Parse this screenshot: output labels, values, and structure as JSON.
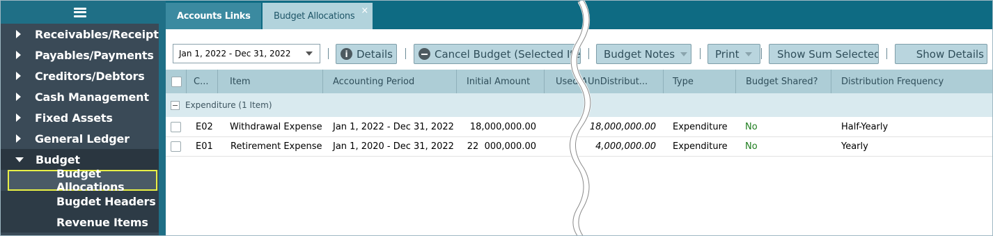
{
  "sidebar": {
    "items": [
      {
        "label": "Receivables/Receipts"
      },
      {
        "label": "Payables/Payments"
      },
      {
        "label": "Creditors/Debtors"
      },
      {
        "label": "Cash Management"
      },
      {
        "label": "Fixed Assets"
      },
      {
        "label": "General Ledger"
      },
      {
        "label": "Budget"
      }
    ],
    "sub_items": [
      {
        "label": "Budget Allocations",
        "active": true
      },
      {
        "label": "Bugdet Headers"
      },
      {
        "label": "Revenue Items"
      }
    ]
  },
  "tabs": [
    {
      "label": "Accounts Links"
    },
    {
      "label": "Budget Allocations",
      "active": true,
      "close": "×"
    }
  ],
  "toolbar": {
    "period_value": "Jan 1, 2022 - Dec 31, 2022",
    "details_label": "Details",
    "cancel_label": "Cancel Budget (Selected Iter",
    "notes_label": "Budget Notes",
    "print_label": "Print",
    "sum_label": "Show Sum Selected",
    "show_details_label": "Show Details"
  },
  "grid": {
    "columns": [
      "C...",
      "Item",
      "Accounting Period",
      "Initial Amount",
      "Used A",
      "UnDistribut...",
      "Type",
      "Budget Shared?",
      "Distribution Frequency"
    ],
    "group_label": "Expenditure (1 Item)",
    "rows": [
      {
        "code": "E02",
        "item": "Withdrawal Expense",
        "period": "Jan 1, 2022 - Dec 31, 2022",
        "initial": "18,000,000.00",
        "undistributed": "18,000,000.00",
        "type": "Expenditure",
        "shared": "No",
        "frequency": "Half-Yearly"
      },
      {
        "code": "E01",
        "item": "Retirement Expense",
        "period": "Jan 1, 2020 - Dec 31, 2022",
        "initial_a": "22",
        "initial_b": "000,000.00",
        "undistributed": "4,000,000.00",
        "type": "Expenditure",
        "shared": "No",
        "frequency": "Yearly"
      }
    ]
  },
  "colors": {
    "teal": "#0e6b83",
    "sidebar": "#3a4a57",
    "highlight": "#e8f046",
    "yes_no_green": "#1e7d1e"
  }
}
